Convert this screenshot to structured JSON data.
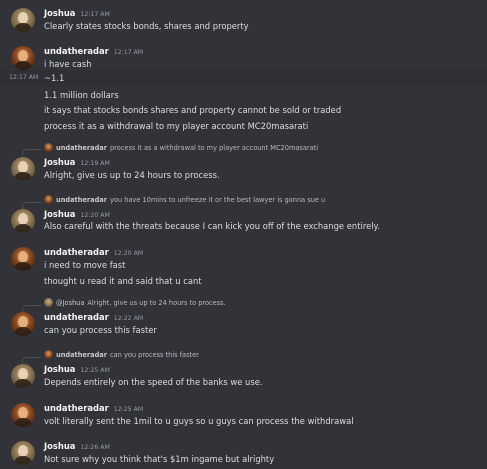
{
  "messages": [
    {
      "author": "Joshua",
      "time": "12:17 AM",
      "lines": [
        "Clearly states stocks bonds, shares and property"
      ]
    },
    {
      "author": "undatheradar",
      "time": "12:17 AM",
      "lines": [
        "i have cash"
      ]
    },
    {
      "side_time": "12:17 AM",
      "lines": [
        "~1.1"
      ]
    },
    {
      "lines": [
        "1.1 million dollars",
        "it says that stocks bonds shares and property cannot be sold or traded",
        "process it as a withdrawal to my player account MC20masarati"
      ]
    },
    {
      "reply": {
        "author": "undatheradar",
        "text": "process it as a withdrawal to my player account MC20masarati"
      },
      "author": "Joshua",
      "time": "12:19 AM",
      "lines": [
        "Alright, give us up to 24 hours to process."
      ]
    },
    {
      "reply": {
        "author": "undatheradar",
        "text": "you have 10mins to unfreeze it or the best lawyer is gonna sue u"
      },
      "author": "Joshua",
      "time": "12:20 AM",
      "lines": [
        "Also careful with the threats because I can kick you off of the exchange entirely."
      ]
    },
    {
      "author": "undatheradar",
      "time": "12:20 AM",
      "lines": [
        "i need to move fast",
        "thought u read it and said that u cant"
      ]
    },
    {
      "reply": {
        "author": "@Joshua",
        "text": "Alright, give us up to 24 hours to process."
      },
      "author": "undatheradar",
      "time": "12:22 AM",
      "lines": [
        "can you process this faster"
      ]
    },
    {
      "reply": {
        "author": "undatheradar",
        "text": "can you process this faster"
      },
      "author": "Joshua",
      "time": "12:25 AM",
      "lines": [
        "Depends entirely on the speed of the banks we use."
      ]
    },
    {
      "author": "undatheradar",
      "time": "12:25 AM",
      "lines": [
        "volt literally sent the 1mil to u guys so u guys can process the withdrawal"
      ]
    },
    {
      "author": "Joshua",
      "time": "12:26 AM",
      "lines": [
        "Not sure why you think that's $1m ingame but alrighty"
      ]
    }
  ]
}
